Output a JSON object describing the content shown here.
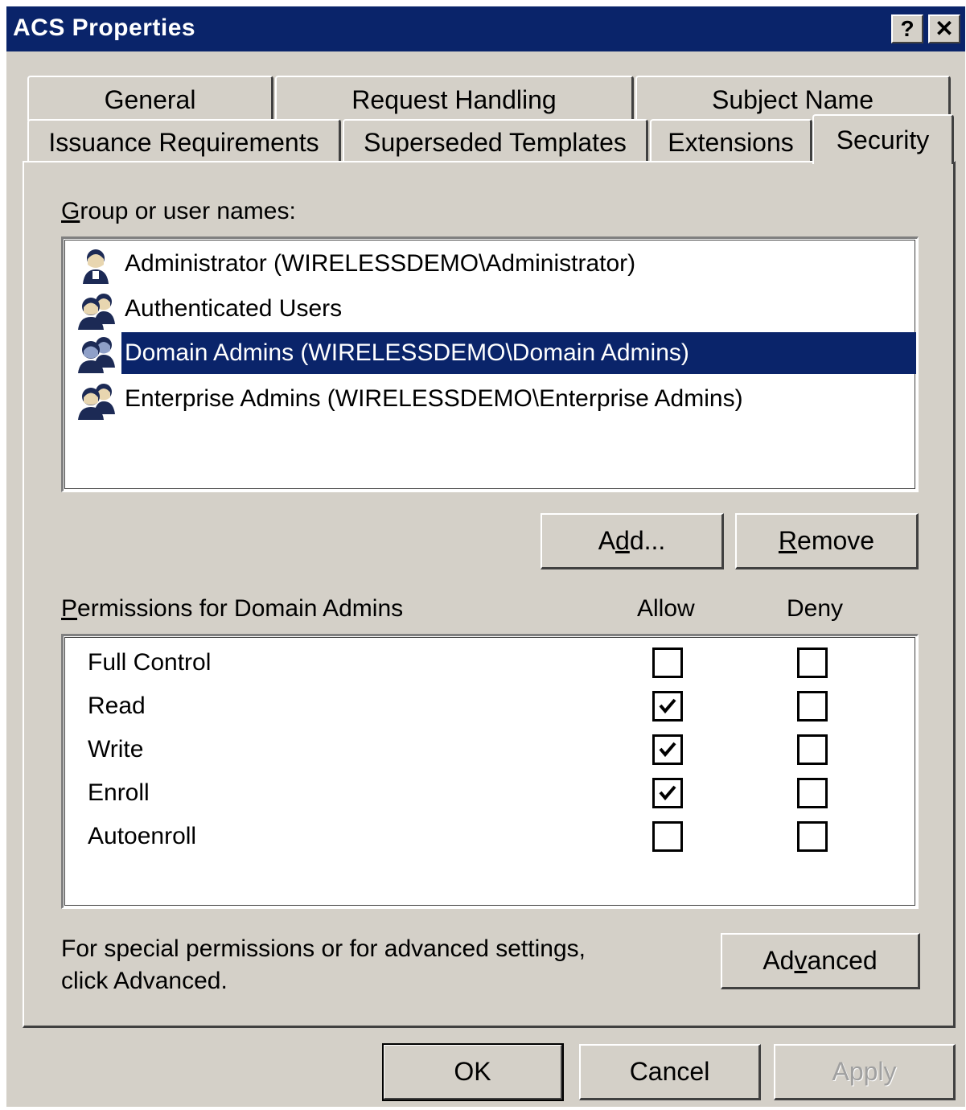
{
  "window": {
    "title": "ACS Properties"
  },
  "titlebar_buttons": {
    "help": "?",
    "close": "✕"
  },
  "tabs_row1": [
    "General",
    "Request Handling",
    "Subject Name"
  ],
  "tabs_row2": [
    "Issuance Requirements",
    "Superseded Templates",
    "Extensions",
    "Security"
  ],
  "active_tab": "Security",
  "group_label": {
    "accel": "G",
    "rest": "roup or user names:"
  },
  "users": [
    {
      "name": "Administrator (WIRELESSDEMO\\Administrator)",
      "icon": "user-icon"
    },
    {
      "name": "Authenticated Users",
      "icon": "users-group-icon"
    },
    {
      "name": "Domain Admins (WIRELESSDEMO\\Domain Admins)",
      "icon": "users-group-icon",
      "selected": true
    },
    {
      "name": "Enterprise Admins (WIRELESSDEMO\\Enterprise Admins)",
      "icon": "users-group-icon"
    }
  ],
  "buttons": {
    "add": {
      "pre": "A",
      "accel": "d",
      "post": "d..."
    },
    "remove": {
      "pre": "",
      "accel": "R",
      "post": "emove"
    },
    "advanced": {
      "pre": "Ad",
      "accel": "v",
      "post": "anced"
    },
    "ok": "OK",
    "cancel": "Cancel",
    "apply": "Apply"
  },
  "permissions_label": {
    "accel": "P",
    "rest": "ermissions for Domain Admins"
  },
  "columns": {
    "allow": "Allow",
    "deny": "Deny"
  },
  "permissions": [
    {
      "name": "Full Control",
      "allow": false,
      "deny": false
    },
    {
      "name": "Read",
      "allow": true,
      "deny": false
    },
    {
      "name": "Write",
      "allow": true,
      "deny": false
    },
    {
      "name": "Enroll",
      "allow": true,
      "deny": false
    },
    {
      "name": "Autoenroll",
      "allow": false,
      "deny": false
    }
  ],
  "advanced_hint": {
    "line1": "For special permissions or for advanced settings,",
    "line2": "click Advanced."
  },
  "colors": {
    "titlebar": "#0a246a",
    "face": "#d4d0c8",
    "selection": "#0a246a"
  }
}
